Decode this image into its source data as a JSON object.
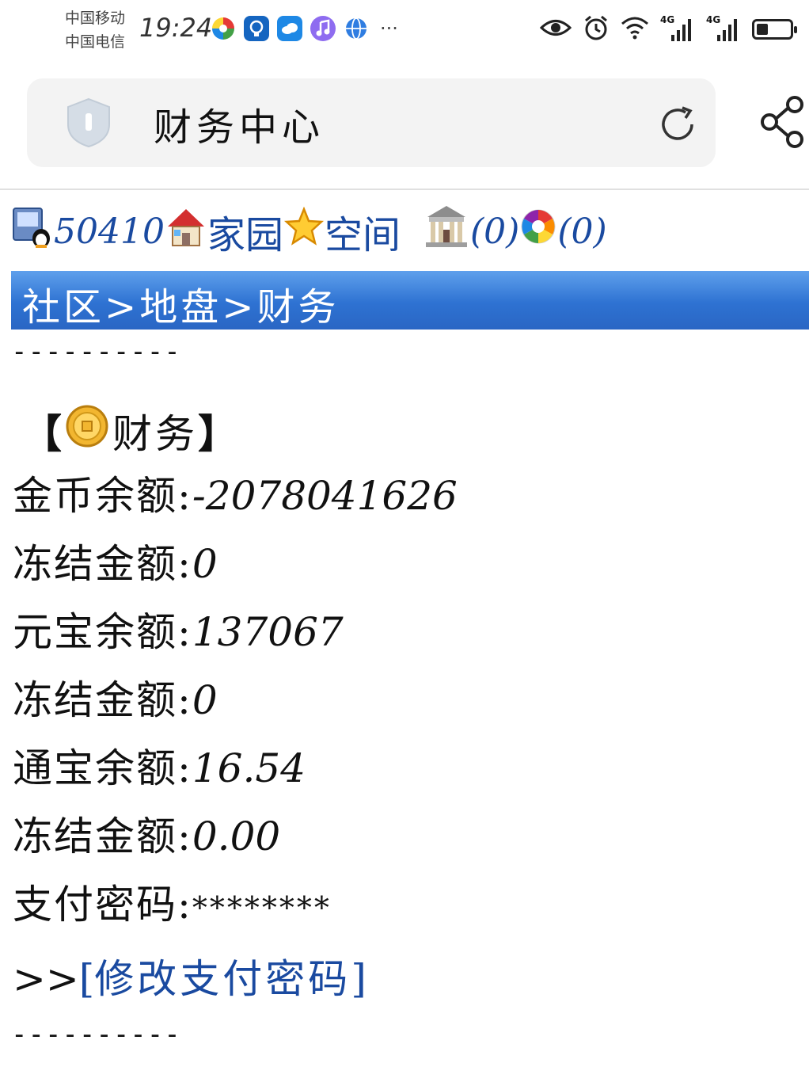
{
  "status_bar": {
    "carrier_1": "中国移动",
    "carrier_2": "中国电信",
    "time": "19:24",
    "more": "···",
    "battery_level": 0.35,
    "net_1": "4G",
    "net_2": "4G"
  },
  "browser": {
    "title": "财务中心"
  },
  "top_links": {
    "user_id": "50410",
    "home": "家园",
    "space": "空间",
    "count_1": "(0)",
    "count_2": "(0)"
  },
  "breadcrumb": "社区>地盘>财务",
  "divider": "----------",
  "section": {
    "open": "【",
    "label": "财务",
    "close": "】"
  },
  "rows": [
    {
      "label": "金币余额:",
      "value": "-2078041626"
    },
    {
      "label": "冻结金额:",
      "value": "0"
    },
    {
      "label": "元宝余额:",
      "value": "137067"
    },
    {
      "label": "冻结金额:",
      "value": "0"
    },
    {
      "label": "通宝余额:",
      "value": "16.54"
    },
    {
      "label": "冻结金额:",
      "value": "0.00"
    },
    {
      "label": "支付密码:",
      "value": "********"
    }
  ],
  "change_password": {
    "prefix": ">>",
    "open": "[",
    "label": "修改支付密码",
    "close": "]"
  },
  "colors": {
    "link": "#1a4aa0",
    "band_top": "#5fa0ec",
    "band_bottom": "#2a66c4"
  }
}
